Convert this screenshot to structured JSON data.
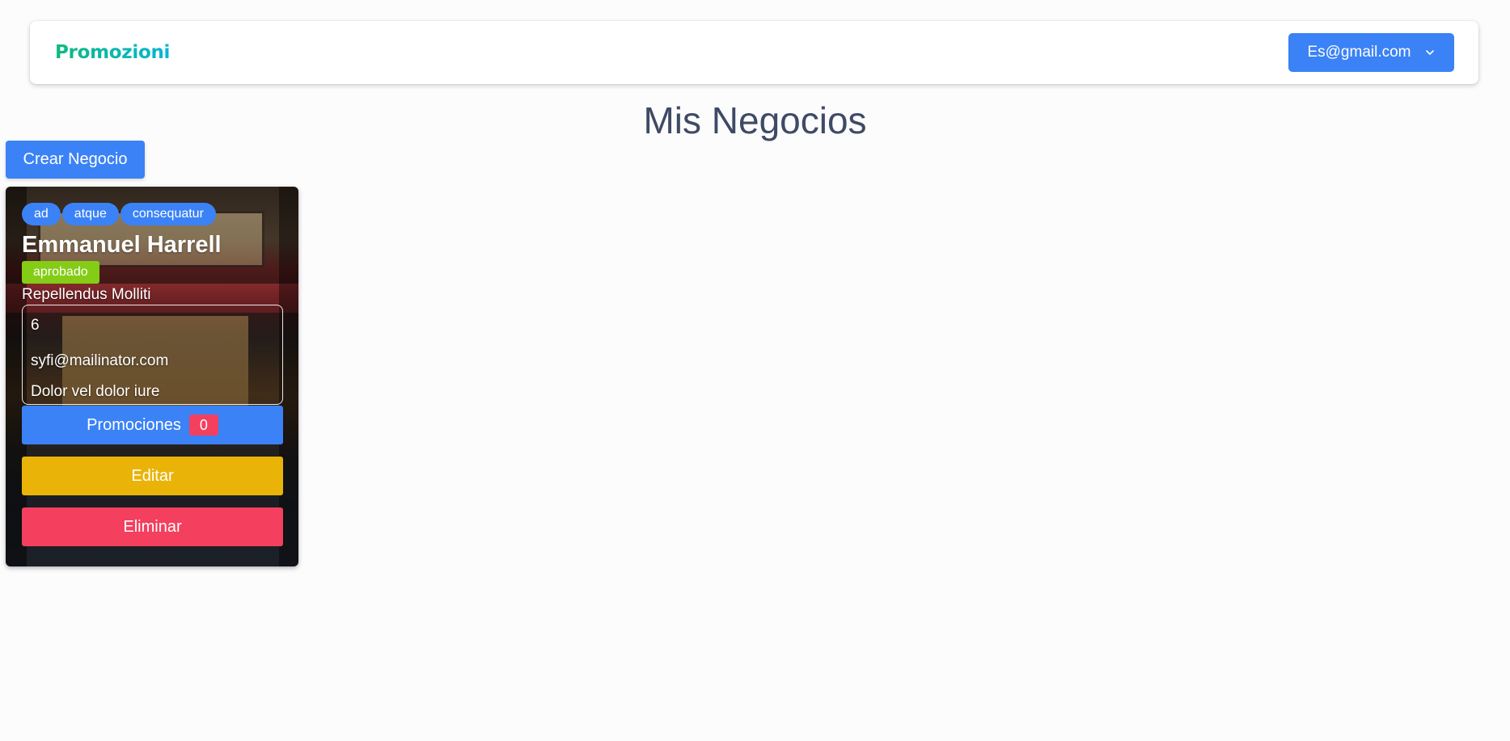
{
  "navbar": {
    "brand": "Promozioni",
    "user_email": "Es@gmail.com",
    "dropdown_icon": "chevron-down-icon"
  },
  "page": {
    "title": "Mis Negocios",
    "create_button": "Crear Negocio"
  },
  "business_card": {
    "tags": [
      "ad",
      "atque",
      "consequatur"
    ],
    "name": "Emmanuel Harrell",
    "status": "aprobado",
    "subtitle": "Repellendus Molliti",
    "phone": "6",
    "email": "syfi@mailinator.com",
    "address": "Dolor vel dolor iure",
    "promotions_label": "Promociones",
    "promotions_count": "0",
    "edit_label": "Editar",
    "delete_label": "Eliminar"
  },
  "colors": {
    "primary": "#3b82f6",
    "success": "#84cc16",
    "warning": "#eab308",
    "danger": "#f43f5e",
    "brand_gradient_start": "#10b981",
    "brand_gradient_end": "#06b6d4"
  }
}
